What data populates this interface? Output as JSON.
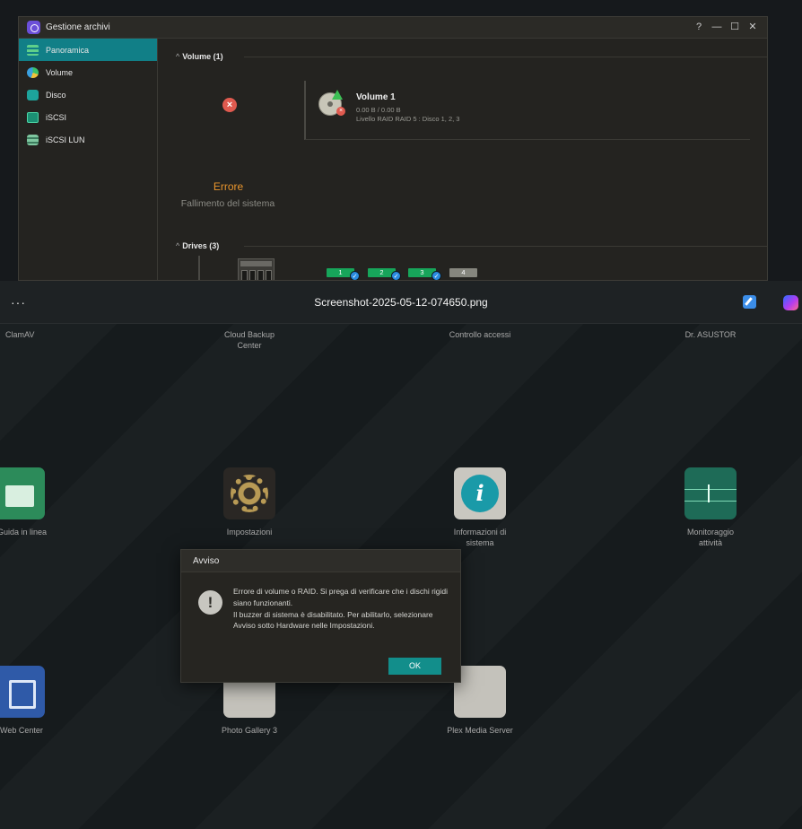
{
  "storage_window": {
    "title": "Gestione archivi",
    "controls": [
      "?",
      "—",
      "☐",
      "✕"
    ],
    "sidebar": [
      {
        "label": "Panoramica",
        "active": true
      },
      {
        "label": "Volume"
      },
      {
        "label": "Disco"
      },
      {
        "label": "iSCSI"
      },
      {
        "label": "iSCSI LUN"
      }
    ],
    "volume_section": {
      "header": "Volume (1)",
      "status_title": "Errore",
      "status_message": "Fallimento del sistema",
      "volume_name": "Volume 1",
      "volume_size": "0.00 B / 0.00 B",
      "volume_raid": "Livello RAID RAID 5 : Disco 1, 2, 3"
    },
    "drives_section": {
      "header": "Drives (3)",
      "bays": [
        {
          "label": "1",
          "status": "ok"
        },
        {
          "label": "2",
          "status": "ok"
        },
        {
          "label": "3",
          "status": "ok"
        },
        {
          "label": "4",
          "status": "empty"
        }
      ]
    }
  },
  "viewer": {
    "more_label": "···",
    "file_name": "Screenshot-2025-05-12-074650.png"
  },
  "desktop": {
    "row1": [
      "ClamAV",
      "Cloud Backup Center",
      "Controllo accessi",
      "Dr. ASUSTOR"
    ],
    "row2": [
      "Guida in linea",
      "Impostazioni",
      "Informazioni di sistema",
      "Monitoraggio attività"
    ],
    "row3": [
      "Web Center",
      "Photo Gallery 3",
      "Plex Media Server"
    ]
  },
  "dialog": {
    "title": "Avviso",
    "line1": "Errore di volume o RAID. Si prega di verificare che i dischi rigidi siano funzionanti.",
    "line2": "Il buzzer di sistema è disabilitato. Per abilitarlo, selezionare Avviso sotto Hardware nelle Impostazioni.",
    "ok_label": "OK"
  }
}
